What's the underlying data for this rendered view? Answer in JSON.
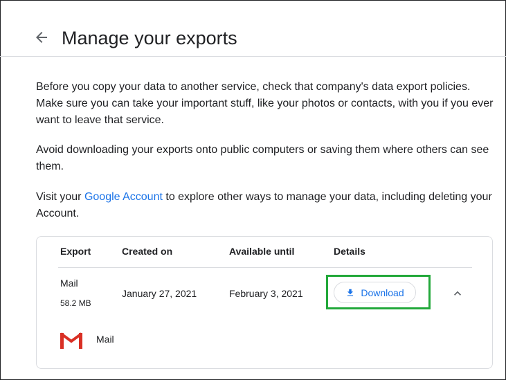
{
  "header": {
    "title": "Manage your exports",
    "back_icon": "arrow-back-icon"
  },
  "intro": {
    "paragraph1": "Before you copy your data to another service, check that company's data export policies. Make sure you can take your important stuff, like your photos or contacts, with you if you ever want to leave that service.",
    "paragraph2": "Avoid downloading your exports onto public computers or saving them where others can see them.",
    "paragraph3_prefix": "Visit your ",
    "paragraph3_link": "Google Account",
    "paragraph3_suffix": " to explore other ways to manage your data, including deleting your Account."
  },
  "table": {
    "columns": [
      "Export",
      "Created on",
      "Available until",
      "Details"
    ],
    "row": {
      "export_name": "Mail",
      "export_size": "58.2 MB",
      "created_on": "January 27, 2021",
      "available_until": "February 3, 2021",
      "download_label": "Download",
      "download_icon": "download-icon",
      "expand_icon": "chevron-up-icon"
    },
    "products": [
      {
        "icon": "gmail-icon",
        "label": "Mail"
      }
    ]
  },
  "colors": {
    "accent": "#1a73e8",
    "highlight": "#22a83a",
    "border": "#dadce0",
    "text": "#202124"
  }
}
